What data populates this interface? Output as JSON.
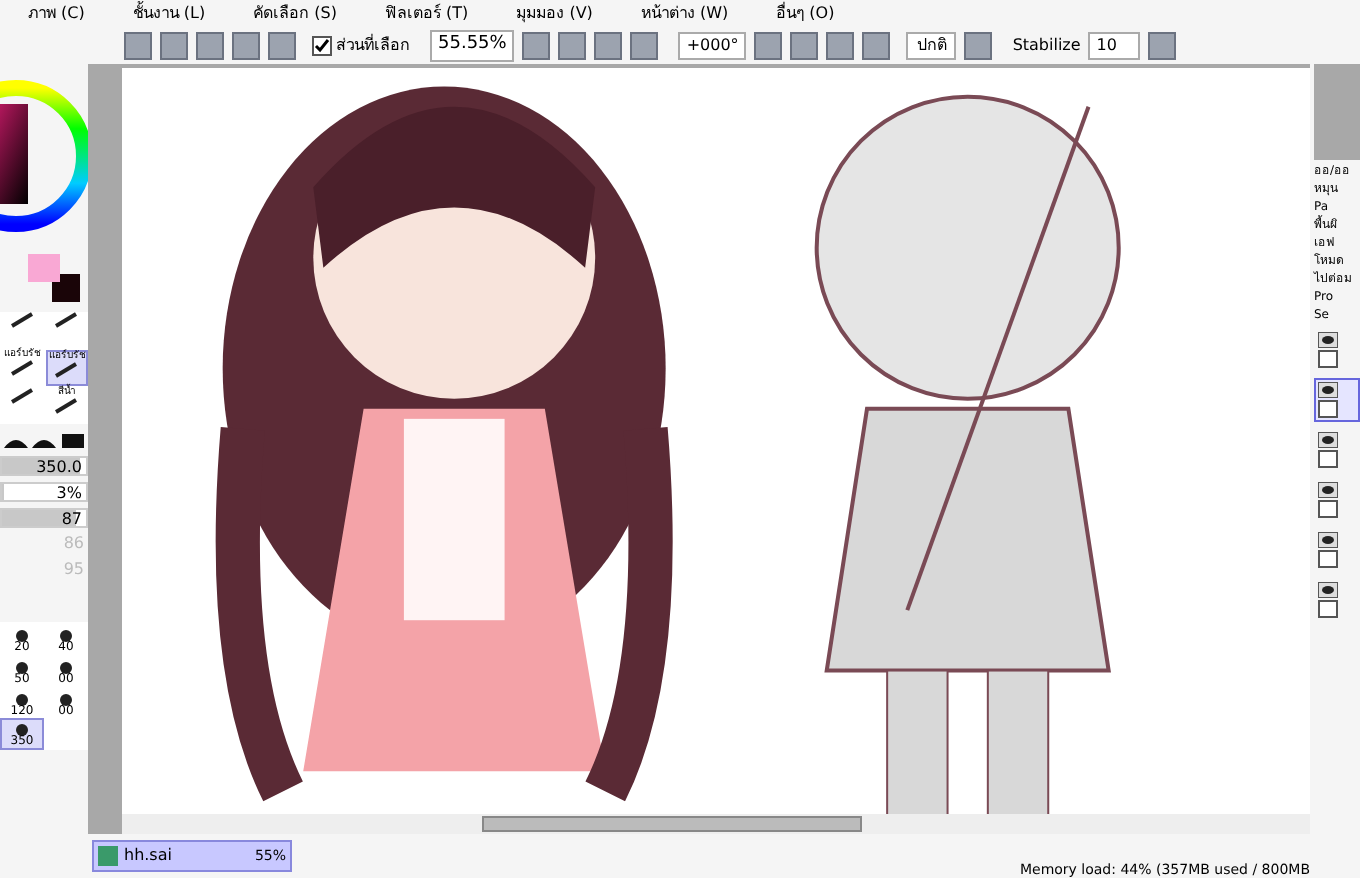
{
  "menu": [
    "ภาพ (C)",
    "ชั้นงาน (L)",
    "คัดเลือก (S)",
    "ฟิลเตอร์ (T)",
    "มุมมอง (V)",
    "หน้าต่าง (W)",
    "อื่นๆ (O)"
  ],
  "toolbar": {
    "selection_checkbox": {
      "label": "ส่วนที่เลือก",
      "checked": true
    },
    "zoom": "55.55%",
    "rotation": "+000°",
    "blend": "ปกติ",
    "stabilizer_label": "Stabilize",
    "stabilizer": "10"
  },
  "left_panel": {
    "color_swatches": [
      {
        "kind": "primary",
        "color": "#f9a8d4"
      },
      {
        "kind": "secondary",
        "color": "#1a0508"
      }
    ],
    "tools": [
      {
        "selected": false
      },
      {
        "selected": false
      },
      {
        "label": "แอร์บรัช",
        "selected": false
      },
      {
        "label": "แอร์บรัช",
        "selected": true
      },
      {
        "selected": false
      },
      {
        "label": "สีน้ำ",
        "selected": false
      }
    ],
    "sliders": [
      {
        "value": "350.0",
        "level": 0.93
      },
      {
        "value": "3%",
        "level": 0.03
      },
      {
        "value": "87",
        "level": 0.87
      }
    ],
    "value_a": "86",
    "value_b": "95",
    "brush_sizes": [
      {
        "label": "20",
        "selected": false
      },
      {
        "label": "40",
        "selected": false
      },
      {
        "label": "50",
        "selected": false
      },
      {
        "label": "00",
        "selected": false
      },
      {
        "label": "120",
        "selected": false
      },
      {
        "label": "00",
        "selected": false
      },
      {
        "label": "350",
        "selected": true
      }
    ]
  },
  "right_panel": {
    "texts": [
      "ออ/ออ",
      "หมุน",
      "Pa",
      "พื้นผิ",
      "เอฟ",
      "โหมด",
      "ไปต่อม",
      "Pro",
      "Se"
    ],
    "layers": [
      {
        "selected": false
      },
      {
        "selected": true
      },
      {
        "selected": false
      },
      {
        "selected": false
      },
      {
        "selected": false
      },
      {
        "selected": false
      }
    ]
  },
  "document_tab": {
    "name": "hh.sai",
    "zoom": "55%",
    "selected": true
  },
  "status_bar": "Memory load: 44% (357MB used / 800MB"
}
